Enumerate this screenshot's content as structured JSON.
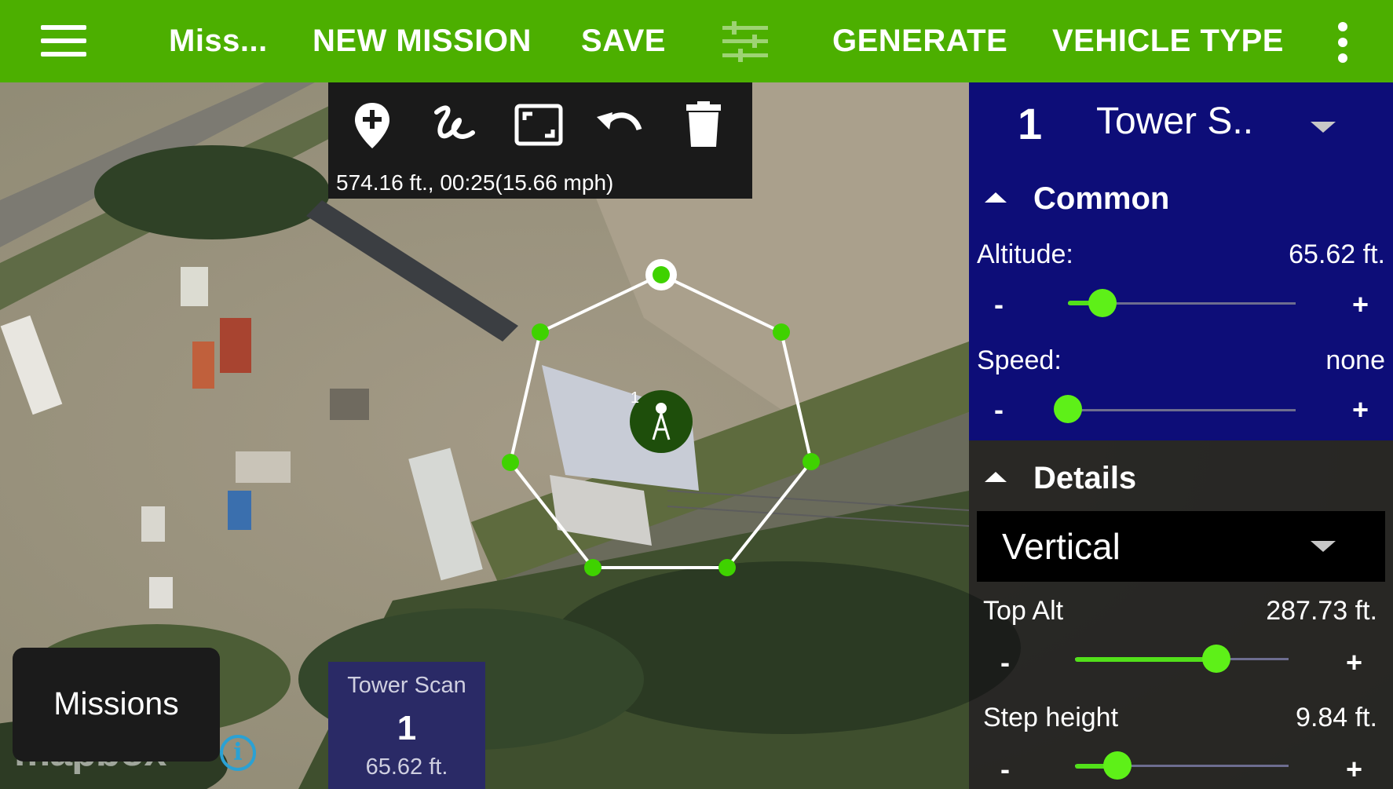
{
  "appbar": {
    "mission_name": "Miss...",
    "new_mission": "NEW MISSION",
    "save": "SAVE",
    "generate": "GENERATE",
    "vehicle_type": "VEHICLE TYPE",
    "bg_color": "#4caf00"
  },
  "toolbar": {
    "tools": [
      "add-waypoint-icon",
      "draw-path-icon",
      "fit-view-icon",
      "undo-icon",
      "delete-icon"
    ],
    "stats": "574.16 ft., 00:25(15.66 mph)"
  },
  "map": {
    "waypoint_number": "1",
    "orbit_vertex_count": 7,
    "attribution": "mapbox"
  },
  "panel": {
    "index": "1",
    "item_type": "Tower S..",
    "common": {
      "header": "Common",
      "altitude_label": "Altitude:",
      "altitude_value": "65.62 ft.",
      "altitude_level": 0.15,
      "speed_label": "Speed:",
      "speed_value": "none",
      "speed_level": 0.0
    },
    "details": {
      "header": "Details",
      "direction": "Vertical",
      "top_alt_label": "Top Alt",
      "top_alt_value": "287.73 ft.",
      "top_alt_level": 0.66,
      "step_height_label": "Step height",
      "step_height_value": "9.84 ft.",
      "step_height_level": 0.2
    },
    "minus": "-",
    "plus": "+",
    "accent_color": "#5ef018",
    "header_bg": "#0d0d78"
  },
  "bottom": {
    "missions_button": "Missions",
    "card_title": "Tower Scan",
    "card_number": "1",
    "card_alt": "65.62 ft."
  }
}
